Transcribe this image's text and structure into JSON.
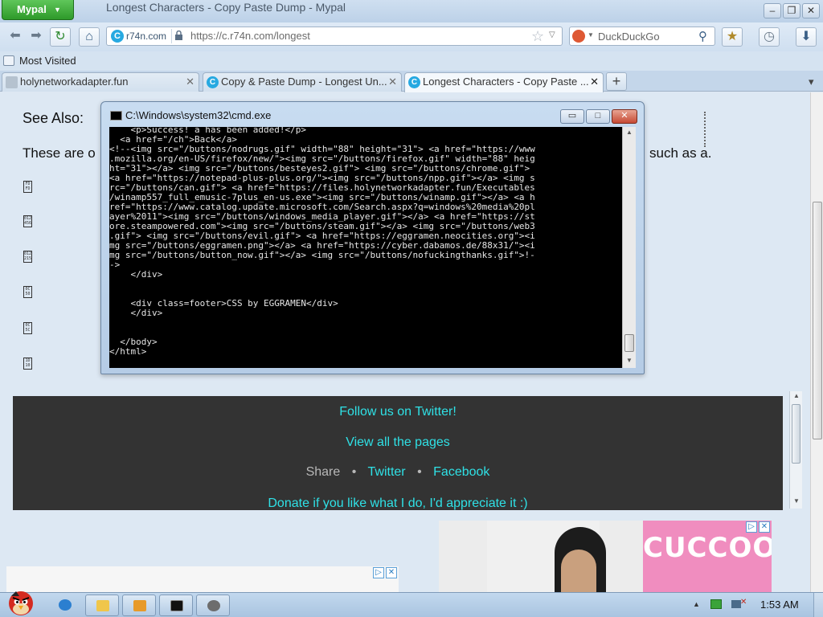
{
  "browser": {
    "app_menu": "Mypal",
    "window_title": "Longest Characters - Copy Paste Dump - Mypal",
    "site_identity": "r74n.com",
    "url": "https://c.r74n.com/longest",
    "search_engine_placeholder": "DuckDuckGo",
    "bookmarks": [
      "Most Visited"
    ],
    "tabs": [
      {
        "label": "holynetworkadapter.fun",
        "active": false
      },
      {
        "label": "Copy & Paste Dump - Longest Un...",
        "active": false
      },
      {
        "label": "Longest Characters - Copy Paste ...",
        "active": true
      }
    ],
    "new_tab_label": "+"
  },
  "page": {
    "see_also": "See Also:",
    "intro_start": "These are o",
    "intro_end": "such as a.",
    "glyphs": [
      "FD FD",
      "012 456",
      "012 215",
      "0C 50",
      "0C 5C",
      "1D 10"
    ],
    "footer": {
      "follow": "Follow us on Twitter!",
      "view_all": "View all the pages",
      "share_label": "Share",
      "twitter": "Twitter",
      "facebook": "Facebook",
      "donate": "Donate if you like what I do, I'd appreciate it :)"
    },
    "ad_brand": "CUCCOO"
  },
  "cmd": {
    "title": "C:\\Windows\\system32\\cmd.exe",
    "lines": [
      "    <p>Success! a has been added!</p>",
      "  <a href=\"/ch\">Back</a>",
      "<!--<img src=\"/buttons/nodrugs.gif\" width=\"88\" height=\"31\"> <a href=\"https://www",
      ".mozilla.org/en-US/firefox/new/\"><img src=\"/buttons/firefox.gif\" width=\"88\" heig",
      "ht=\"31\"></a> <img src=\"/buttons/besteyes2.gif\"> <img src=\"/buttons/chrome.gif\">",
      "<a href=\"https://notepad-plus-plus.org/\"><img src=\"/buttons/npp.gif\"></a> <img s",
      "rc=\"/buttons/can.gif\"> <a href=\"https://files.holynetworkadapter.fun/Executables",
      "/winamp557_full_emusic-7plus_en-us.exe\"><img src=\"/buttons/winamp.gif\"></a> <a h",
      "ref=\"https://www.catalog.update.microsoft.com/Search.aspx?q=windows%20media%20pl",
      "ayer%2011\"><img src=\"/buttons/windows_media_player.gif\"></a> <a href=\"https://st",
      "ore.steampowered.com\"><img src=\"/buttons/steam.gif\"></a> <img src=\"/buttons/web3",
      ".gif\"> <img src=\"/buttons/evil.gif\"> <a href=\"https://eggramen.neocities.org\"><i",
      "mg src=\"/buttons/eggramen.png\"></a> <a href=\"https://cyber.dabamos.de/88x31/\"><i",
      "mg src=\"/buttons/button_now.gif\"></a> <img src=\"/buttons/nofuckingthanks.gif\">!-",
      "->",
      "    </div>",
      "",
      "",
      "    <div class=footer>CSS by EGGRAMEN</div>",
      "    </div>",
      "",
      "",
      "  </body>",
      "</html>"
    ]
  },
  "taskbar": {
    "clock": "1:53 AM",
    "items": [
      "internet-explorer",
      "explorer-folder",
      "media-player",
      "command-prompt",
      "raccoon-app"
    ]
  },
  "colors": {
    "footer_bg": "#333333",
    "footer_link": "#2fe1e6",
    "page_bg": "#dde8f3",
    "ad_pink": "#f08dbf"
  }
}
